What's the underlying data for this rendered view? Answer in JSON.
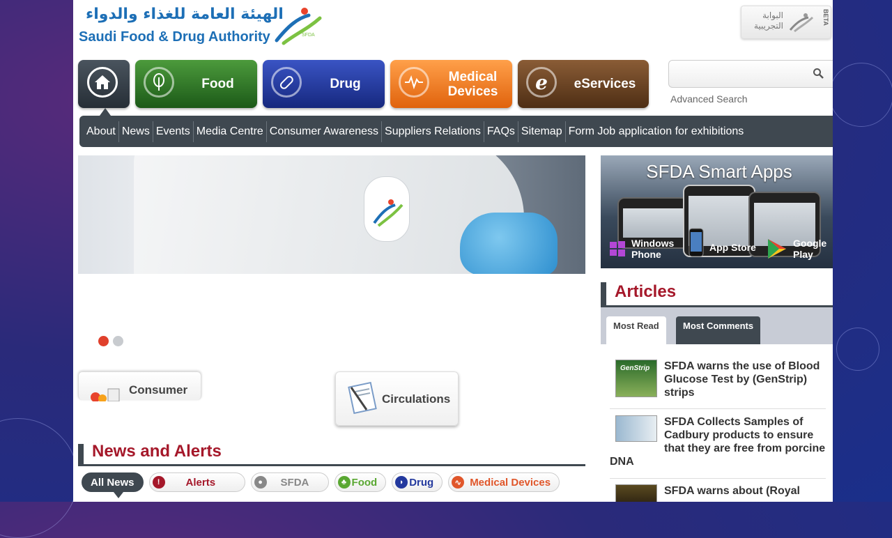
{
  "header": {
    "logo_ar": "الهيئة العامة للغذاء والدواء",
    "logo_en": "Saudi Food & Drug Authority",
    "logo_mark": "SFDA",
    "beta_ar_line1": "البوابة",
    "beta_ar_line2": "التجريبية",
    "beta_tag": "BETA"
  },
  "mainnav": {
    "food": "Food",
    "drug": "Drug",
    "medical_line1": "Medical",
    "medical_line2": "Devices",
    "eservices": "eServices"
  },
  "search": {
    "placeholder": "",
    "advanced": "Advanced Search"
  },
  "subnav": {
    "items": [
      "About",
      "News",
      "Events",
      "Media Centre",
      "Consumer Awareness",
      "Suppliers Relations",
      "FAQs",
      "Sitemap",
      "Form Job application for exhibitions"
    ]
  },
  "tiles": {
    "consumer": "Consumer",
    "circulations": "Circulations"
  },
  "news": {
    "title": "News and Alerts",
    "filters": [
      "All News",
      "Alerts",
      "SFDA",
      "Food",
      "Drug",
      "Medical Devices"
    ]
  },
  "apps": {
    "title": "SFDA Smart Apps",
    "windows_l1": "Windows",
    "windows_l2": "Phone",
    "appstore": "App Store",
    "google_l1": "Google",
    "google_l2": "Play"
  },
  "articles": {
    "title": "Articles",
    "tab_read": "Most Read",
    "tab_comments": "Most Comments",
    "items": [
      "SFDA warns the use of Blood Glucose Test by (GenStrip) strips",
      "SFDA Collects Samples of Cadbury products to ensure that they are free from porcine DNA",
      "SFDA warns about (Royal"
    ],
    "thumb1_label": "GenStrip"
  },
  "colors": {
    "accent_red": "#a5182a",
    "nav_dark": "#3f4850",
    "food": "#2f7a28",
    "drug": "#23399e",
    "medical": "#f07d22",
    "eservices": "#6e4626"
  }
}
